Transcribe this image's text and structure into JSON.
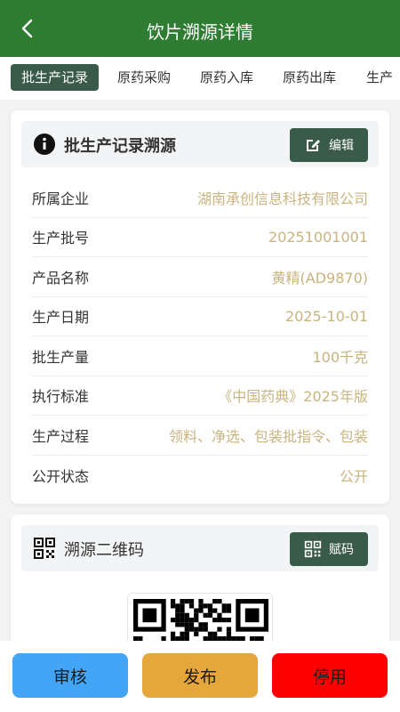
{
  "header": {
    "title": "饮片溯源详情"
  },
  "tabs": [
    "批生产记录",
    "原药采购",
    "原药入库",
    "原药出库",
    "生产"
  ],
  "record_card": {
    "title": "批生产记录溯源",
    "edit_label": "编辑",
    "rows": [
      {
        "label": "所属企业",
        "value": "湖南承创信息科技有限公司"
      },
      {
        "label": "生产批号",
        "value": "20251001001"
      },
      {
        "label": "产品名称",
        "value": "黄精(AD9870)"
      },
      {
        "label": "生产日期",
        "value": "2025-10-01"
      },
      {
        "label": "批生产量",
        "value": "100千克"
      },
      {
        "label": "执行标准",
        "value": "《中国药典》2025年版"
      },
      {
        "label": "生产过程",
        "value": "领料、净选、包装批指令、包装"
      },
      {
        "label": "公开状态",
        "value": "公开"
      }
    ]
  },
  "qr_card": {
    "title": "溯源二维码",
    "assign_label": "赋码"
  },
  "actions": {
    "review": "审核",
    "publish": "发布",
    "disable": "停用"
  },
  "colors": {
    "primary_green": "#2e7d32",
    "dark_green": "#3a5a4a",
    "value_gold": "#c9b480",
    "review_blue": "#42a5f5",
    "publish_orange": "#e5a63c",
    "disable_red": "#ff0000"
  },
  "icons": {
    "back": "chevron-left-icon",
    "info": "info-icon",
    "edit": "edit-icon",
    "qr": "qr-code-icon"
  }
}
